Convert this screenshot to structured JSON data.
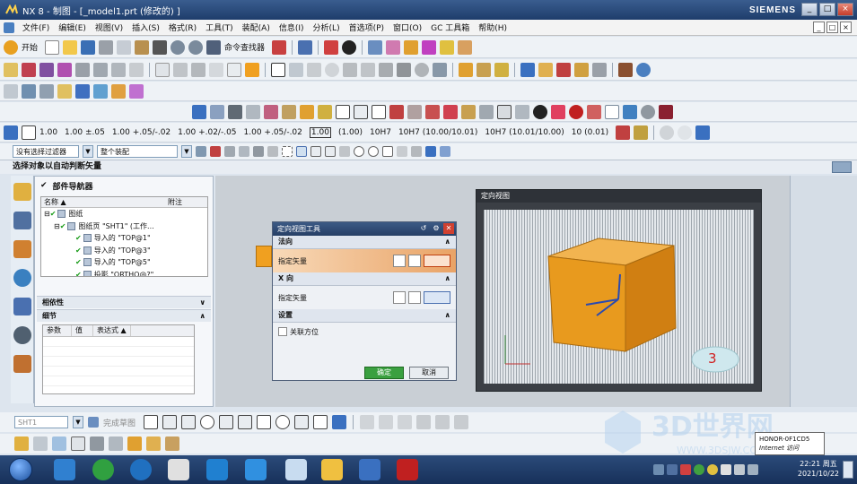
{
  "window": {
    "title": "NX 8 - 制图 - [_model1.prt (修改的) ]",
    "brand": "SIEMENS",
    "controls": [
      "_",
      "□",
      "×"
    ]
  },
  "menu": {
    "items": [
      "文件(F)",
      "编辑(E)",
      "视图(V)",
      "插入(S)",
      "格式(R)",
      "工具(T)",
      "装配(A)",
      "信息(I)",
      "分析(L)",
      "首选项(P)",
      "窗口(O)",
      "GC 工具箱",
      "帮助(H)"
    ],
    "doc_controls": [
      "_",
      "□",
      "×"
    ]
  },
  "toolbar1": {
    "start_label": "开始",
    "command_finder_label": "命令查找器"
  },
  "tolerance_bar": {
    "values": [
      "1.00",
      "1.00 ±.05",
      "1.00 +.05/-.02",
      "1.00 +.02/-.05",
      "1.00 +.05/-.02",
      "1.00",
      "(1.00)",
      "10H7",
      "10H7 (10.00/10.01)",
      "10H7 (10.01/10.00)",
      "10 (0.01)"
    ]
  },
  "filter": {
    "selection_filter": "没有选择过滤器",
    "assembly_scope": "整个装配"
  },
  "status": {
    "prompt": "选择对象以自动判断矢量"
  },
  "navigator": {
    "title": "部件导航器",
    "columns": [
      "名称 ▲",
      "附注"
    ],
    "tree": [
      {
        "label": "图纸",
        "level": 0
      },
      {
        "label": "图纸页 \"SHT1\" (工作...",
        "level": 1
      },
      {
        "label": "导入的 \"TOP@1\"",
        "level": 2
      },
      {
        "label": "导入的 \"TOP@3\"",
        "level": 2
      },
      {
        "label": "导入的 \"TOP@5\"",
        "level": 2
      },
      {
        "label": "投影 \"ORTHO@?\"",
        "level": 2
      }
    ],
    "dependency_label": "相依性",
    "details_label": "细节",
    "detail_columns": [
      "参数",
      "值",
      "表达式 ▲"
    ]
  },
  "dialog": {
    "title": "定向视图工具",
    "sections": {
      "normal": "法向",
      "x_dir": "X 向",
      "settings": "设置"
    },
    "specify_vector": "指定矢量",
    "associative": "关联方位",
    "ok": "确定",
    "cancel": "取消"
  },
  "view_window": {
    "title": "定向视图",
    "step_number": "3"
  },
  "bottom": {
    "sheet_name": "SHT1",
    "sketch_label": "完成草图"
  },
  "taskbar": {
    "time": "22:21 周五",
    "date": "2021/10/22",
    "tooltip_title": "HONOR-0F1CD5",
    "tooltip_sub": "Internet 访问"
  },
  "watermark": {
    "text": "3D世界网",
    "url": "WWW.3DSJW.COM"
  },
  "colors": {
    "accent": "#f0a020",
    "titlebar": "#2a4a78",
    "cube_front": "#e89a1e",
    "cube_top": "#f2b450"
  }
}
